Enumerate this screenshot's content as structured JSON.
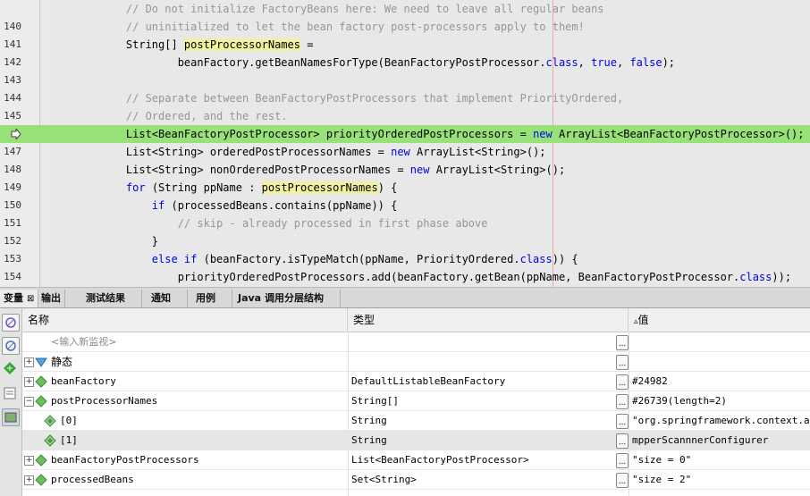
{
  "editor": {
    "lines": [
      {
        "n": "",
        "top": 0,
        "segs": [
          {
            "t": "    // Do not initialize FactoryBeans here: We need to leave all regular beans",
            "c": "cm"
          }
        ]
      },
      {
        "n": "140",
        "segs": [
          {
            "t": "    // uninitialized to let the bean factory post-processors apply to them!",
            "c": "cm"
          }
        ]
      },
      {
        "n": "141",
        "segs": [
          {
            "t": "    String[] "
          },
          {
            "t": "postProcessorNames",
            "c": "hl"
          },
          {
            "t": " ="
          }
        ]
      },
      {
        "n": "142",
        "segs": [
          {
            "t": "            beanFactory.getBeanNamesForType(BeanFactoryPostProcessor."
          },
          {
            "t": "class",
            "c": "kw"
          },
          {
            "t": ", "
          },
          {
            "t": "true",
            "c": "kw"
          },
          {
            "t": ", "
          },
          {
            "t": "false",
            "c": "kw"
          },
          {
            "t": ");"
          }
        ]
      },
      {
        "n": "143",
        "segs": [
          {
            "t": ""
          }
        ]
      },
      {
        "n": "144",
        "segs": [
          {
            "t": "    // Separate between BeanFactoryPostProcessors that implement PriorityOrdered,",
            "c": "cm"
          }
        ]
      },
      {
        "n": "145",
        "segs": [
          {
            "t": "    // Ordered, and the rest.",
            "c": "cm"
          }
        ]
      },
      {
        "n": "",
        "current": true,
        "segs": [
          {
            "t": "    List<BeanFactoryPostProcessor> priorityOrderedPostProcessors = "
          },
          {
            "t": "new",
            "c": "kw"
          },
          {
            "t": " ArrayList<BeanFactoryPostProcessor>();"
          }
        ]
      },
      {
        "n": "147",
        "segs": [
          {
            "t": "    List<String> orderedPostProcessorNames = "
          },
          {
            "t": "new",
            "c": "kw"
          },
          {
            "t": " ArrayList<String>();"
          }
        ]
      },
      {
        "n": "148",
        "segs": [
          {
            "t": "    List<String> nonOrderedPostProcessorNames = "
          },
          {
            "t": "new",
            "c": "kw"
          },
          {
            "t": " ArrayList<String>();"
          }
        ]
      },
      {
        "n": "149",
        "segs": [
          {
            "t": "    "
          },
          {
            "t": "for",
            "c": "kw"
          },
          {
            "t": " (String ppName : "
          },
          {
            "t": "postProcessorNames",
            "c": "hl"
          },
          {
            "t": ") {"
          }
        ]
      },
      {
        "n": "150",
        "segs": [
          {
            "t": "        "
          },
          {
            "t": "if",
            "c": "kw"
          },
          {
            "t": " (processedBeans.contains(ppName)) {"
          }
        ]
      },
      {
        "n": "151",
        "segs": [
          {
            "t": "            // skip - already processed in first phase above",
            "c": "cm"
          }
        ]
      },
      {
        "n": "152",
        "segs": [
          {
            "t": "        }"
          }
        ]
      },
      {
        "n": "153",
        "segs": [
          {
            "t": "        "
          },
          {
            "t": "else if",
            "c": "kw"
          },
          {
            "t": " (beanFactory.isTypeMatch(ppName, PriorityOrdered."
          },
          {
            "t": "class",
            "c": "kw"
          },
          {
            "t": ")) {"
          }
        ]
      },
      {
        "n": "154",
        "segs": [
          {
            "t": "            priorityOrderedPostProcessors.add(beanFactory.getBean(ppName, BeanFactoryPostProcessor."
          },
          {
            "t": "class",
            "c": "kw"
          },
          {
            "t": "));"
          }
        ]
      }
    ]
  },
  "tabs": [
    {
      "label": "变量",
      "close": "⊠",
      "active": true
    },
    {
      "label": "输出"
    },
    {
      "label": "测试结果"
    },
    {
      "label": "通知"
    },
    {
      "label": "用例"
    },
    {
      "label": "Java 调用分层结构"
    }
  ],
  "table": {
    "headers": {
      "name": "名称",
      "type": "类型",
      "value": "值"
    },
    "rows": [
      {
        "name": "<输入新监视>",
        "type": "",
        "value": "",
        "placeholder": true
      },
      {
        "name": "静态",
        "type": "",
        "value": "",
        "expand": "+",
        "icon": "static-icon",
        "sans": true
      },
      {
        "name": "beanFactory",
        "type": "DefaultListableBeanFactory",
        "value": "#24982",
        "expand": "+",
        "icon": "field-icon"
      },
      {
        "name": "postProcessorNames",
        "type": "String[]",
        "value": "#26739(length=2)",
        "expand": "−",
        "icon": "field-icon"
      },
      {
        "name": "[0]",
        "type": "String",
        "value": "\"org.springframework.context.anno",
        "indent": true,
        "icon": "element-icon"
      },
      {
        "name": "[1]",
        "type": "String",
        "value": "mpperScannnerConfigurer",
        "indent": true,
        "icon": "element-icon",
        "selected": true
      },
      {
        "name": "beanFactoryPostProcessors",
        "type": "List<BeanFactoryPostProcessor>",
        "value": "\"size = 0\"",
        "expand": "+",
        "icon": "field-icon"
      },
      {
        "name": "processedBeans",
        "type": "Set<String>",
        "value": "\"size = 2\"",
        "expand": "+",
        "icon": "field-icon"
      }
    ],
    "value_button_label": "..."
  },
  "colors": {
    "current_line": "#98e078",
    "highlight": "#f0f0a0",
    "keyword": "#0000e6",
    "comment": "#969696"
  }
}
